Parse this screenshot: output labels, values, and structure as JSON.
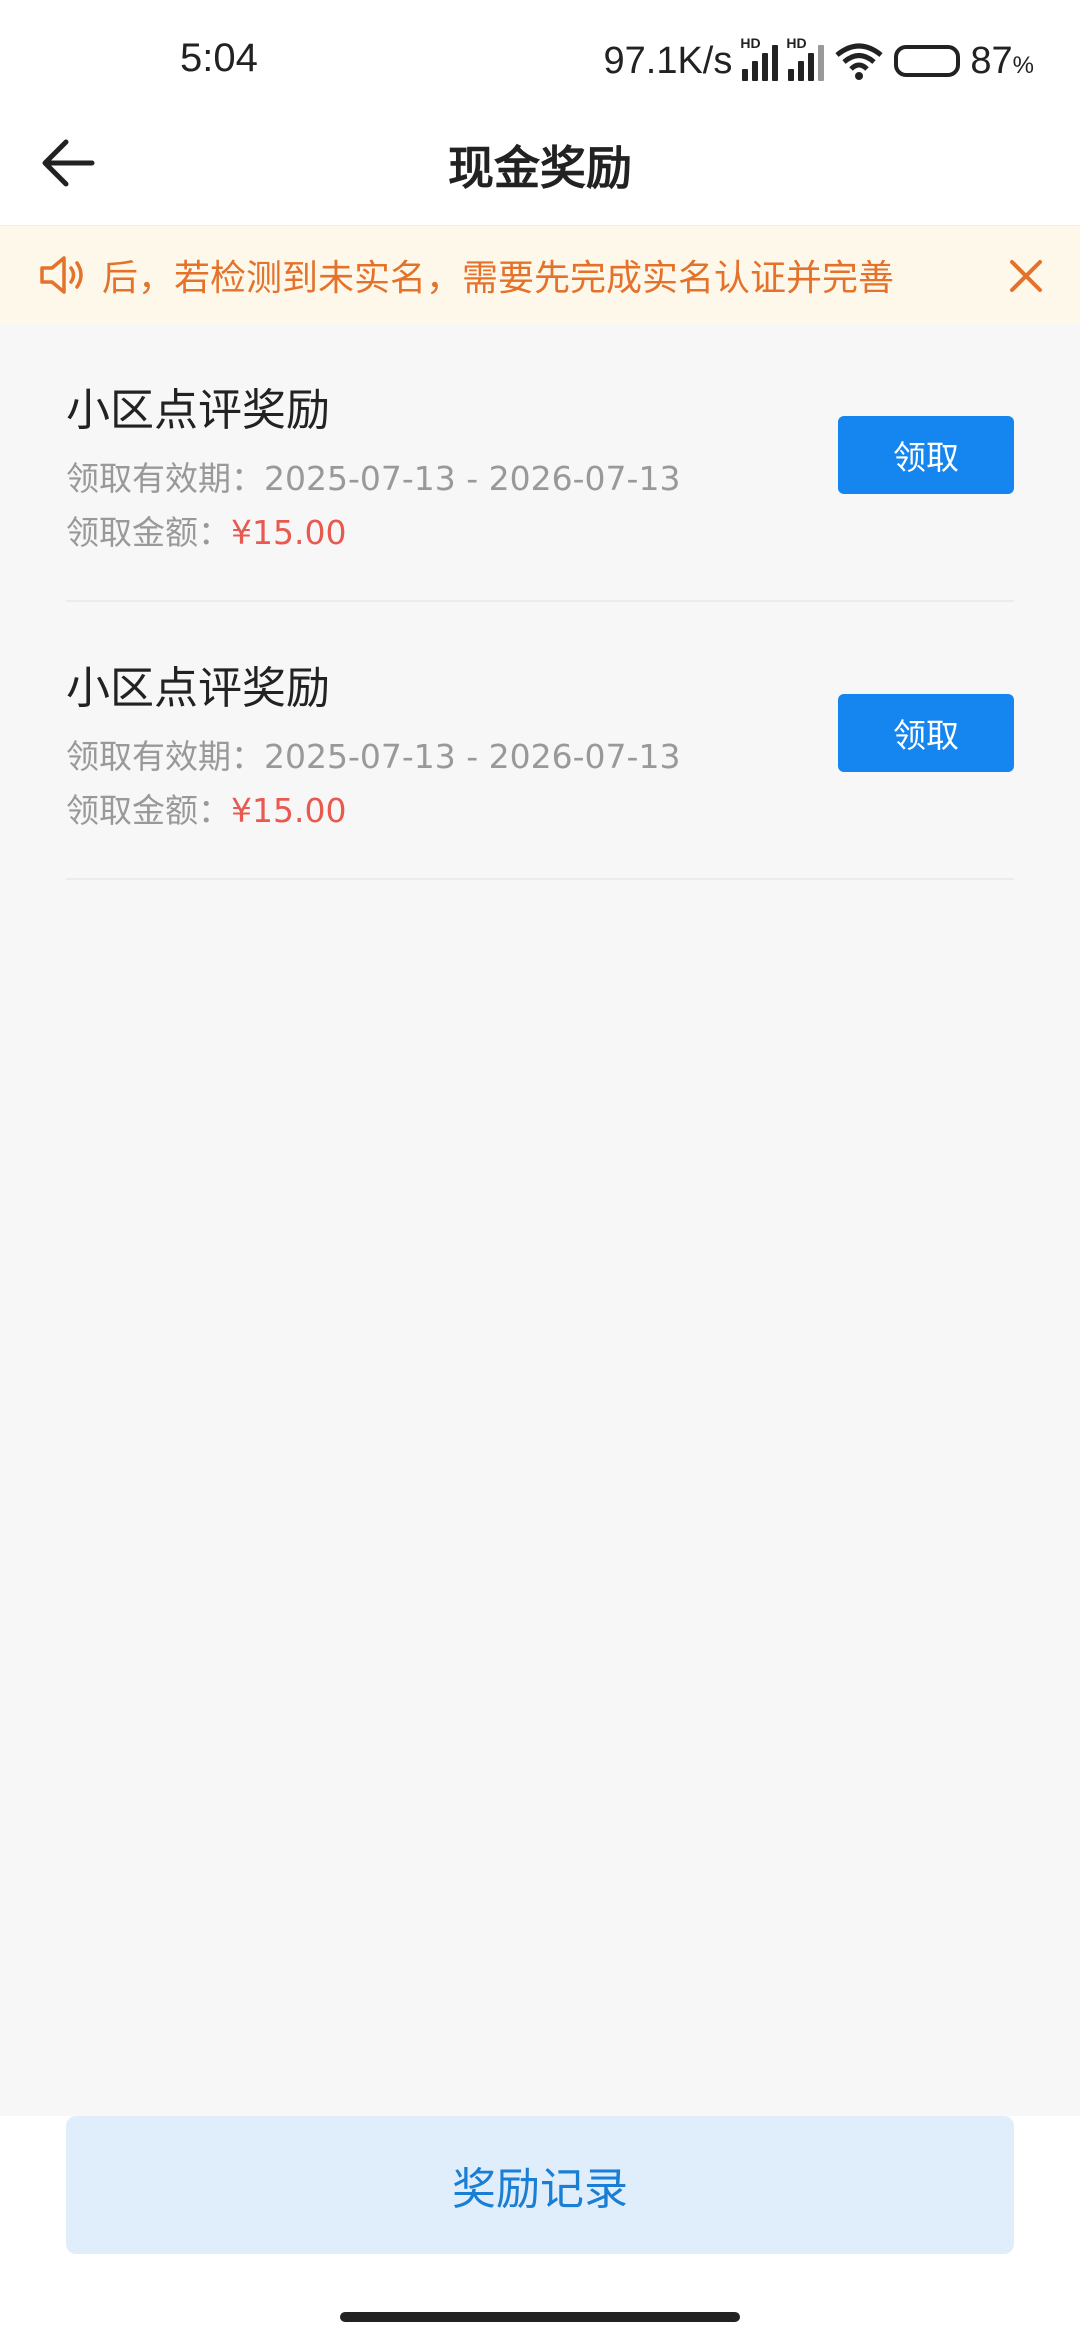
{
  "status_bar": {
    "time": "5:04",
    "net_speed": "97.1K/s",
    "hd_label": "HD",
    "battery": "87",
    "battery_unit": "%"
  },
  "header": {
    "title": "现金奖励",
    "back_icon": "arrow-left-icon"
  },
  "notice": {
    "text": "后，若检测到未实名，需要先完成实名认证并完善",
    "icon": "speaker-icon",
    "close_icon": "close-icon",
    "color": "#e4722a"
  },
  "rewards": [
    {
      "title": "小区点评奖励",
      "period_label": "领取有效期：",
      "period": "2025-07-13 - 2026-07-13",
      "amount_label": "领取金额：",
      "amount": "¥15.00",
      "button": "领取"
    },
    {
      "title": "小区点评奖励",
      "period_label": "领取有效期：",
      "period": "2025-07-13 - 2026-07-13",
      "amount_label": "领取金额：",
      "amount": "¥15.00",
      "button": "领取"
    }
  ],
  "bottom": {
    "record_button": "奖励记录"
  },
  "colors": {
    "accent": "#1585f0",
    "amount": "#e85a4f",
    "notice_bg": "#fdf8ea"
  }
}
